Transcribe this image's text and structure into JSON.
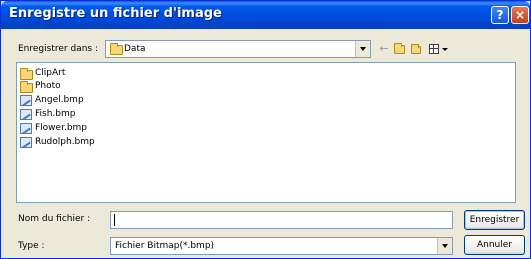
{
  "window": {
    "title": "Enregistre un fichier d'image",
    "help_label": "?",
    "close_label": "×"
  },
  "location": {
    "label": "Enregistrer dans :",
    "selected": "Data",
    "icons": [
      "back-arrow-icon",
      "up-folder-icon",
      "new-folder-icon",
      "view-menu-icon"
    ]
  },
  "files": [
    {
      "name": "ClipArt",
      "type": "folder"
    },
    {
      "name": "Photo",
      "type": "folder"
    },
    {
      "name": "Angel.bmp",
      "type": "bitmap"
    },
    {
      "name": "Fish.bmp",
      "type": "bitmap"
    },
    {
      "name": "Flower.bmp",
      "type": "bitmap"
    },
    {
      "name": "Rudolph.bmp",
      "type": "bitmap"
    }
  ],
  "filename": {
    "label": "Nom du fichier :",
    "value": ""
  },
  "filetype": {
    "label": "Type :",
    "selected": "Fichier Bitmap(*.bmp)"
  },
  "buttons": {
    "save": "Enregistrer",
    "cancel": "Annuler"
  },
  "colors": {
    "titlebar": "#0054e3",
    "face": "#ece9d8",
    "border": "#7f9db9"
  }
}
